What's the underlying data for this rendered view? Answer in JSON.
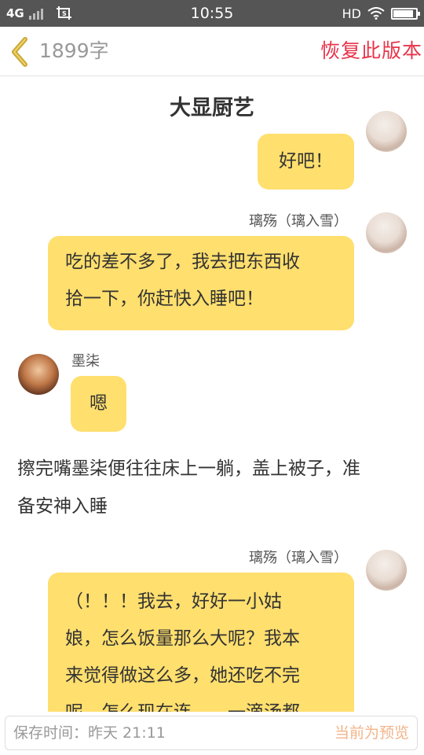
{
  "status_bar": {
    "network": "4G",
    "time": "10:55",
    "hd": "HD",
    "battery_level": 0.95
  },
  "header": {
    "word_count": "1899字",
    "restore_label": "恢复此版本"
  },
  "chapter": {
    "title": "大显厨艺"
  },
  "messages": [
    {
      "side": "right",
      "text": "好吧！"
    },
    {
      "side": "right",
      "sender": "璃殇（璃入雪）",
      "lines": [
        "吃的差不多了，我去把东西收",
        "拾一下，你赶快入睡吧！"
      ]
    },
    {
      "side": "left",
      "sender": "墨柒",
      "text": "嗯"
    },
    {
      "side": "right",
      "sender": "璃殇（璃入雪）",
      "lines": [
        "（！！！我去，好好一小姑",
        "娘，怎么饭量那么大呢？我本",
        "来觉得做这么多，她还吃不完",
        "呢，怎么现在连……一滴汤都"
      ]
    }
  ],
  "narration": {
    "lines": [
      "擦完嘴墨柒便往往床上一躺，盖上被子，准",
      "备安神入睡"
    ]
  },
  "footer": {
    "save_time": "保存时间：昨天 21:11",
    "status": "当前为预览"
  },
  "colors": {
    "bubble": "#ffdf6e",
    "accent_red": "#e8344a",
    "footer_status": "#f2b489",
    "back_arrow": "#c9a93a"
  }
}
